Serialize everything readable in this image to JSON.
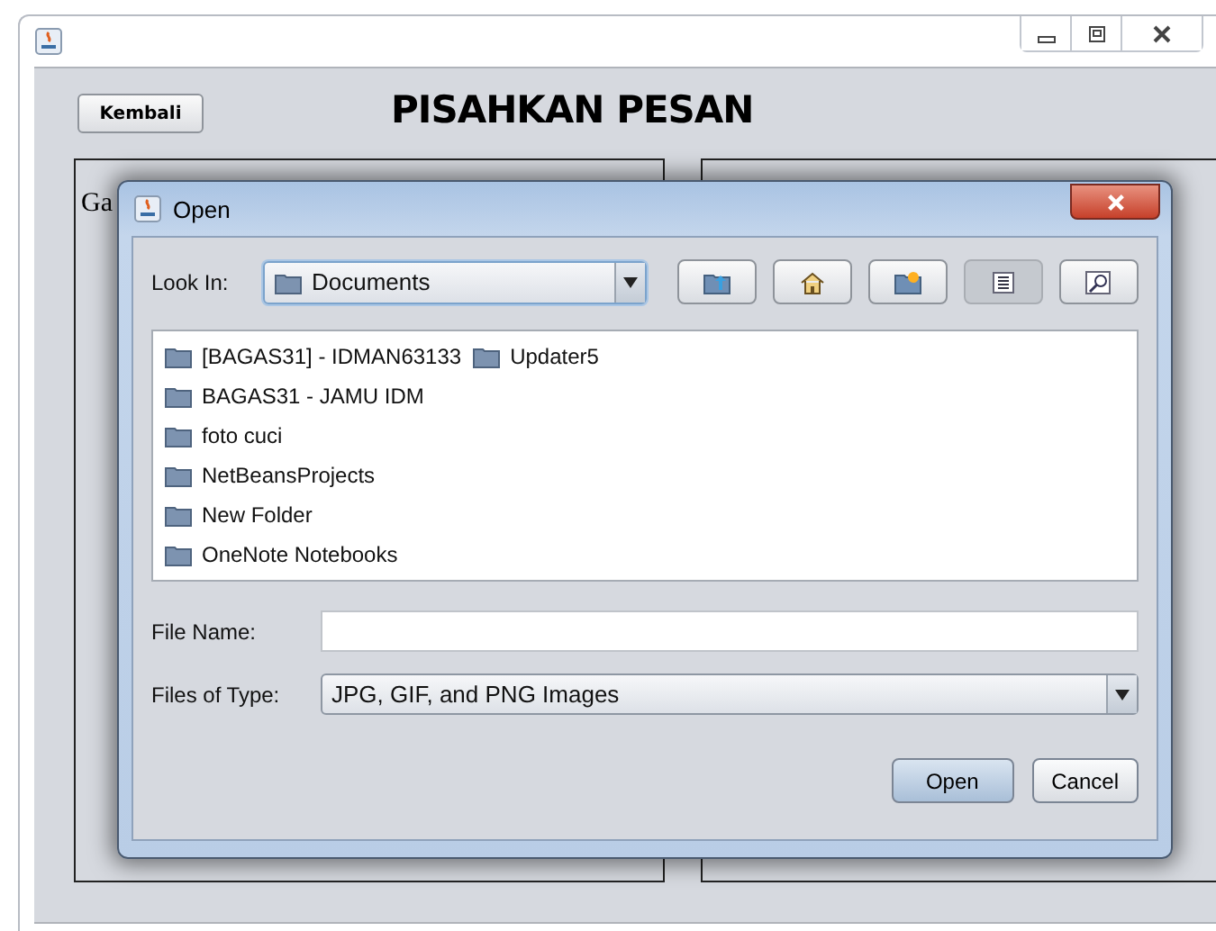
{
  "window": {
    "title": "PISAHKAN PESAN"
  },
  "back_button": "Kembali",
  "left_panel": {
    "label": "Ga"
  },
  "dialog": {
    "title": "Open",
    "look_in_label": "Look In:",
    "look_in_value": "Documents",
    "files": [
      {
        "name": "[BAGAS31] - IDMAN63133"
      },
      {
        "name": "BAGAS31 - JAMU IDM"
      },
      {
        "name": "foto cuci"
      },
      {
        "name": "NetBeansProjects"
      },
      {
        "name": "New Folder"
      },
      {
        "name": "OneNote Notebooks"
      },
      {
        "name": "Updater5"
      }
    ],
    "toolbar": [
      {
        "kind": "up",
        "selected": false
      },
      {
        "kind": "home",
        "selected": false
      },
      {
        "kind": "newfolder",
        "selected": false
      },
      {
        "kind": "list",
        "selected": true
      },
      {
        "kind": "details",
        "selected": false
      }
    ],
    "file_name_label": "File Name:",
    "type_label": "Files of Type:",
    "type_value": "JPG, GIF, and PNG Images",
    "buttons": [
      "Open",
      "Cancel"
    ]
  }
}
